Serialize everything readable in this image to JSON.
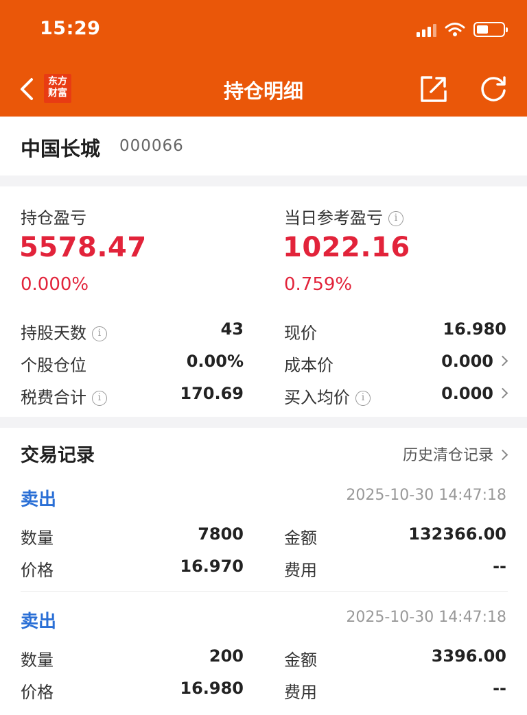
{
  "status": {
    "time": "15:29"
  },
  "header": {
    "logo_line1": "东方",
    "logo_line2": "财富",
    "title": "持仓明细"
  },
  "stock": {
    "name": "中国长城",
    "code": "000066"
  },
  "summary": {
    "position_pl_label": "持仓盈亏",
    "position_pl_value": "5578.47",
    "position_pl_pct": "0.000%",
    "daily_pl_label": "当日参考盈亏",
    "daily_pl_value": "1022.16",
    "daily_pl_pct": "0.759%"
  },
  "details": {
    "holding_days_label": "持股天数",
    "holding_days_value": "43",
    "position_ratio_label": "个股仓位",
    "position_ratio_value": "0.00%",
    "fees_label": "税费合计",
    "fees_value": "170.69",
    "current_price_label": "现价",
    "current_price_value": "16.980",
    "cost_price_label": "成本价",
    "cost_price_value": "0.000",
    "avg_buy_label": "买入均价",
    "avg_buy_value": "0.000"
  },
  "trades": {
    "title": "交易记录",
    "history_link": "历史清仓记录",
    "records": [
      {
        "type": "卖出",
        "time": "2025-10-30 14:47:18",
        "qty_label": "数量",
        "qty": "7800",
        "amount_label": "金额",
        "amount": "132366.00",
        "price_label": "价格",
        "price": "16.970",
        "fee_label": "费用",
        "fee": "--"
      },
      {
        "type": "卖出",
        "time": "2025-10-30 14:47:18",
        "qty_label": "数量",
        "qty": "200",
        "amount_label": "金额",
        "amount": "3396.00",
        "price_label": "价格",
        "price": "16.980",
        "fee_label": "费用",
        "fee": "--"
      }
    ]
  },
  "colors": {
    "brand": "#ea5709",
    "profit_red": "#e2233a",
    "trade_blue": "#2a6fd6"
  },
  "icons": {
    "back": "chevron-left-icon",
    "share": "share-icon",
    "refresh": "refresh-icon",
    "info": "info-icon"
  }
}
